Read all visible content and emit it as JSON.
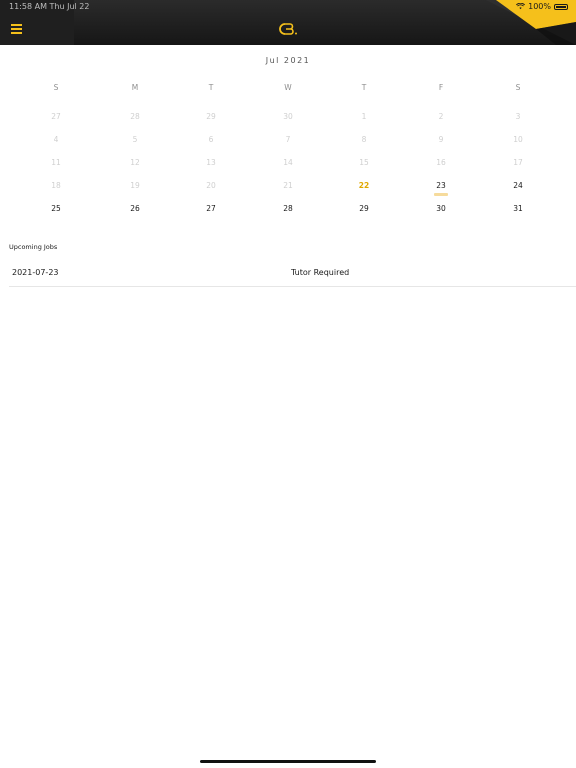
{
  "status_bar": {
    "time": "11:58 AM   Thu Jul 22",
    "battery": "100%"
  },
  "header": {
    "menu_icon": "hamburger-menu-icon",
    "logo_icon": "brand-logo-icon",
    "accent_color": "#f5c01b"
  },
  "calendar": {
    "month_label": "Jul 2021",
    "weekdays": [
      "S",
      "M",
      "T",
      "W",
      "T",
      "F",
      "S"
    ],
    "weeks": [
      [
        {
          "d": "27",
          "s": "outside"
        },
        {
          "d": "28",
          "s": "outside"
        },
        {
          "d": "29",
          "s": "outside"
        },
        {
          "d": "30",
          "s": "outside"
        },
        {
          "d": "1",
          "s": "past"
        },
        {
          "d": "2",
          "s": "past"
        },
        {
          "d": "3",
          "s": "past"
        }
      ],
      [
        {
          "d": "4",
          "s": "past"
        },
        {
          "d": "5",
          "s": "past"
        },
        {
          "d": "6",
          "s": "past"
        },
        {
          "d": "7",
          "s": "past"
        },
        {
          "d": "8",
          "s": "past"
        },
        {
          "d": "9",
          "s": "past"
        },
        {
          "d": "10",
          "s": "past"
        }
      ],
      [
        {
          "d": "11",
          "s": "past"
        },
        {
          "d": "12",
          "s": "past"
        },
        {
          "d": "13",
          "s": "past"
        },
        {
          "d": "14",
          "s": "past"
        },
        {
          "d": "15",
          "s": "past"
        },
        {
          "d": "16",
          "s": "past"
        },
        {
          "d": "17",
          "s": "past"
        }
      ],
      [
        {
          "d": "18",
          "s": "past"
        },
        {
          "d": "19",
          "s": "past"
        },
        {
          "d": "20",
          "s": "past"
        },
        {
          "d": "21",
          "s": "past"
        },
        {
          "d": "22",
          "s": "today"
        },
        {
          "d": "23",
          "s": "current",
          "event": true
        },
        {
          "d": "24",
          "s": "current"
        }
      ],
      [
        {
          "d": "25",
          "s": "current"
        },
        {
          "d": "26",
          "s": "current"
        },
        {
          "d": "27",
          "s": "current"
        },
        {
          "d": "28",
          "s": "current"
        },
        {
          "d": "29",
          "s": "current"
        },
        {
          "d": "30",
          "s": "current"
        },
        {
          "d": "31",
          "s": "current"
        }
      ]
    ],
    "today_color": "#e0a800"
  },
  "upcoming": {
    "title": "Upcoming Jobs",
    "jobs": [
      {
        "date": "2021-07-23",
        "status": "Tutor Required"
      }
    ]
  }
}
